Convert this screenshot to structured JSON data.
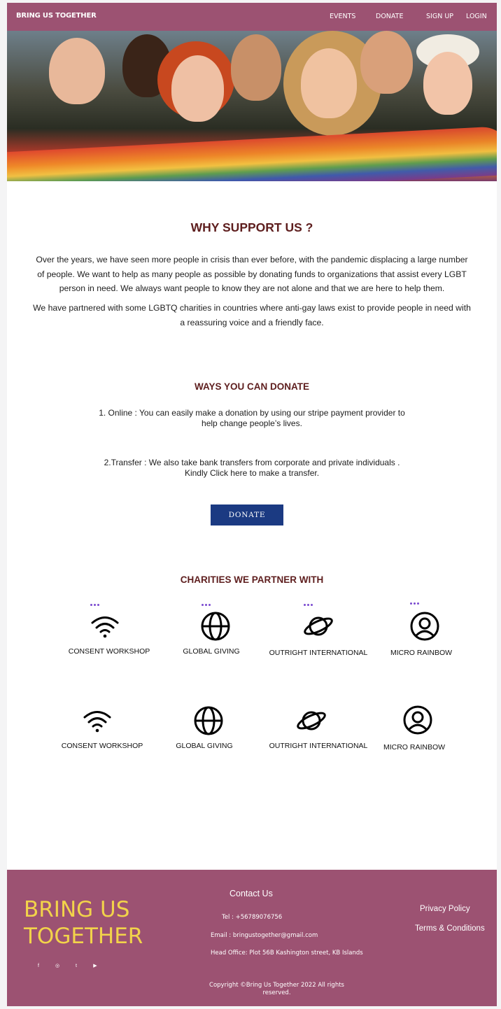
{
  "nav": {
    "brand": "BRING US TOGETHER",
    "links": [
      "EVENTS",
      "DONATE",
      "SIGN UP",
      "LOGIN"
    ]
  },
  "hero": {
    "image_alt": "group-photo-with-rainbow-flag"
  },
  "why": {
    "title": "WHY SUPPORT US ?",
    "para1_lines": [
      "Over the years, we have seen more people in crisis than ever before, with the pandemic displacing a large number",
      "of people. We want to help as many people as possible by donating funds to organizations that assist every LGBT",
      "person in need. We always want people to know they are not alone and that we are here to help them."
    ],
    "para2_lines": [
      "We have partnered with some LGBTQ charities in countries where anti-gay laws exist to provide people in need with",
      "a reassuring voice and a friendly face."
    ]
  },
  "ways": {
    "title": "WAYS YOU CAN DONATE",
    "online_lines": [
      "1. Online : You can easily make a donation by using our stripe payment provider to",
      "help change people’s lives."
    ],
    "transfer_lines": [
      "2.Transfer : We also take bank transfers from corporate and private individuals .",
      "Kindly Click here to make a transfer."
    ],
    "button": "DONATE"
  },
  "charities": {
    "title": "CHARITIES WE PARTNER WITH",
    "row1": [
      {
        "label": "CONSENT WORKSHOP",
        "icon": "wifi-icon"
      },
      {
        "label": "GLOBAL GIVING",
        "icon": "globe-icon"
      },
      {
        "label": "OUTRIGHT INTERNATIONAL",
        "icon": "planet-icon"
      },
      {
        "label": "MICRO RAINBOW",
        "icon": "user-circle-icon"
      }
    ],
    "row2": [
      {
        "label": "CONSENT WORKSHOP",
        "icon": "wifi-icon"
      },
      {
        "label": "GLOBAL GIVING",
        "icon": "globe-icon"
      },
      {
        "label": "OUTRIGHT INTERNATIONAL",
        "icon": "planet-icon"
      },
      {
        "label": "MICRO RAINBOW",
        "icon": "user-circle-icon"
      }
    ]
  },
  "footer": {
    "brand_lines": [
      "BRING US",
      "TOGETHER"
    ],
    "social": [
      "f",
      "◎",
      "t",
      "▶"
    ],
    "contact_title": "Contact Us",
    "tel": "Tel : +56789076756",
    "email": "Email : bringustogether@gmail.com",
    "office": "Head Office:  Plot 56B Kashington street, KB Islands",
    "privacy": "Privacy Policy",
    "terms": "Terms & Conditions",
    "copyright_lines": [
      "Copyright ©Bring Us Together 2022 All rights",
      "reserved."
    ]
  },
  "colors": {
    "nav_bg": "#9c5272",
    "heading": "#5e1e1e",
    "button": "#1b3a82",
    "footer_brand": "#f2d34a",
    "dots": "#7a4ad0"
  }
}
